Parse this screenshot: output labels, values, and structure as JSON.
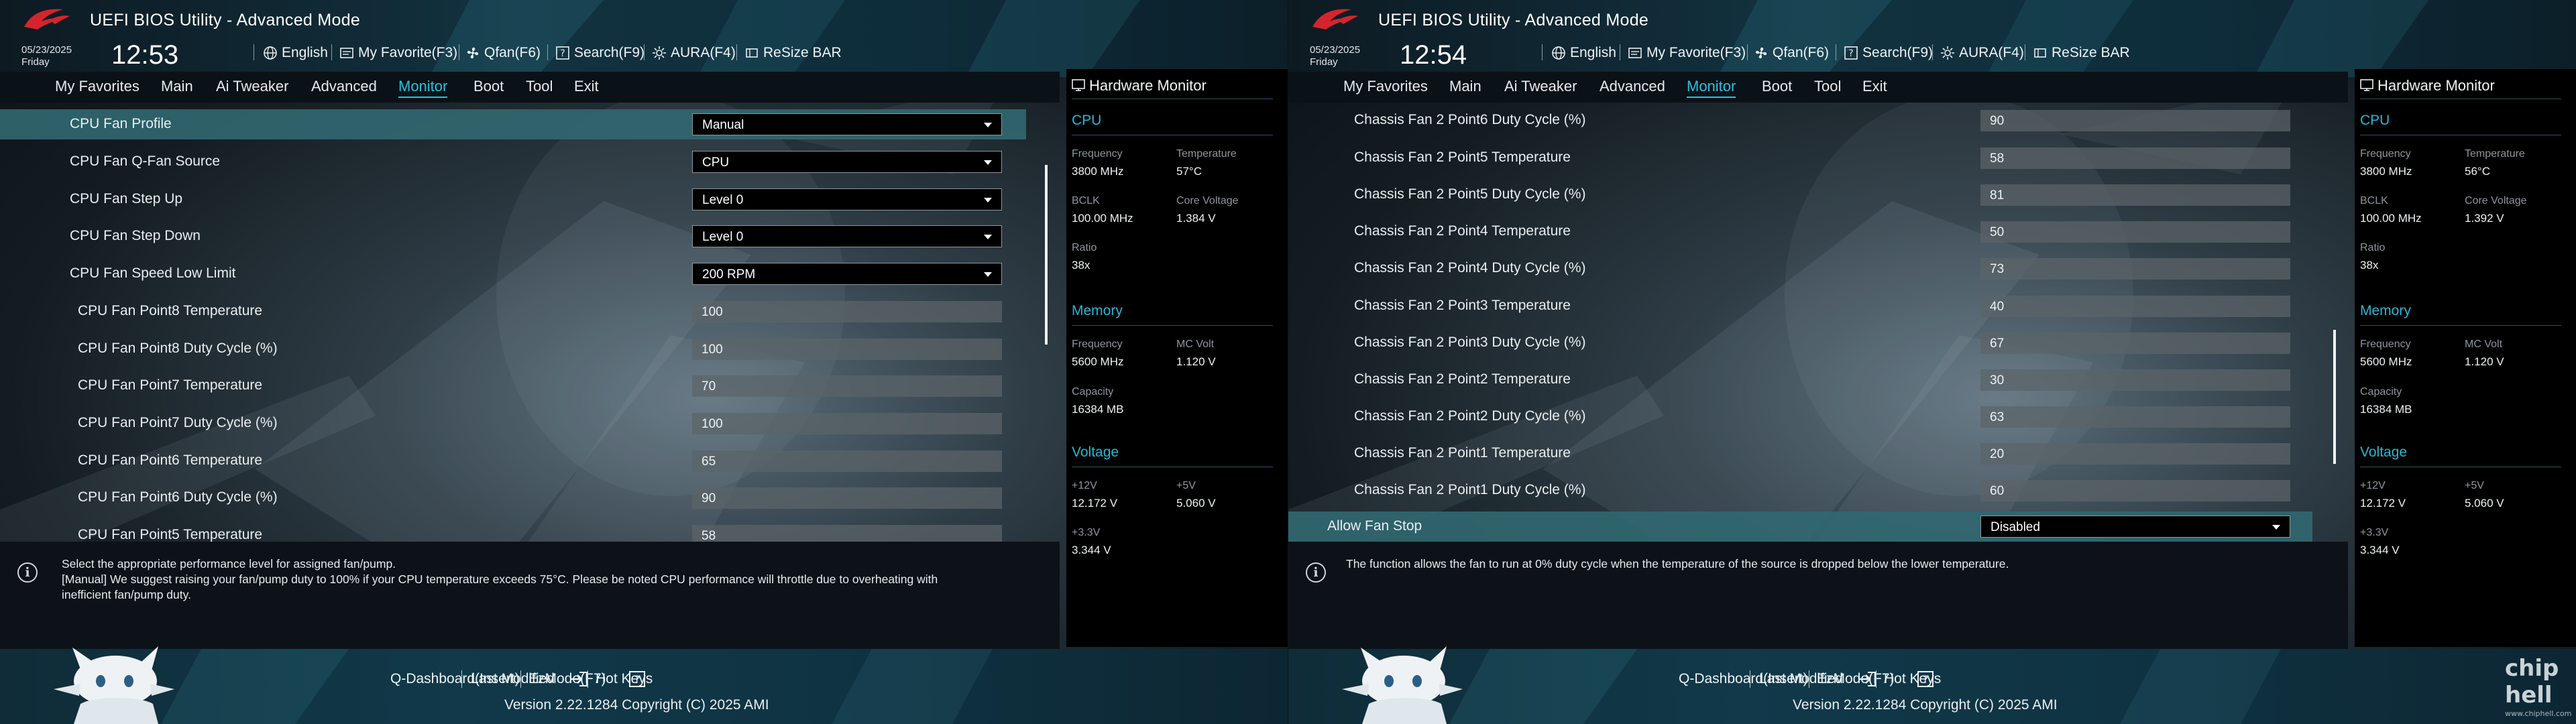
{
  "left": {
    "header": {
      "title": "UEFI BIOS Utility - Advanced Mode",
      "date": "05/23/2025",
      "day": "Friday",
      "time": "12:53",
      "toolbar": {
        "language": "English",
        "favorite": "My Favorite(F3)",
        "qfan": "Qfan(F6)",
        "search": "Search(F9)",
        "aura": "AURA(F4)",
        "resize": "ReSize BAR"
      }
    },
    "menu": [
      "My Favorites",
      "Main",
      "Ai Tweaker",
      "Advanced",
      "Monitor",
      "Boot",
      "Tool",
      "Exit"
    ],
    "active_menu": "Monitor",
    "rows": [
      {
        "label": "CPU Fan Profile",
        "value": "Manual",
        "type": "dropdown",
        "selected": true
      },
      {
        "label": "CPU Fan Q-Fan Source",
        "value": "CPU",
        "type": "dropdown"
      },
      {
        "label": "CPU Fan Step Up",
        "value": "Level 0",
        "type": "dropdown"
      },
      {
        "label": "CPU Fan Step Down",
        "value": "Level 0",
        "type": "dropdown"
      },
      {
        "label": "CPU Fan Speed Low Limit",
        "value": "200 RPM",
        "type": "dropdown"
      },
      {
        "label": "CPU Fan Point8 Temperature",
        "value": "100",
        "type": "input"
      },
      {
        "label": "CPU Fan Point8 Duty Cycle (%)",
        "value": "100",
        "type": "input"
      },
      {
        "label": "CPU Fan Point7 Temperature",
        "value": "70",
        "type": "input"
      },
      {
        "label": "CPU Fan Point7 Duty Cycle (%)",
        "value": "100",
        "type": "input"
      },
      {
        "label": "CPU Fan Point6 Temperature",
        "value": "65",
        "type": "input"
      },
      {
        "label": "CPU Fan Point6 Duty Cycle (%)",
        "value": "90",
        "type": "input"
      },
      {
        "label": "CPU Fan Point5 Temperature",
        "value": "58",
        "type": "input"
      }
    ],
    "help_lines": [
      "Select the appropriate performance level for assigned fan/pump.",
      "[Manual] We suggest raising your fan/pump duty to 100% if your CPU temperature exceeds 75°C. Please be noted CPU performance will throttle due to overheating with",
      "inefficient fan/pump duty."
    ],
    "hw": {
      "title": "Hardware Monitor",
      "cpu": {
        "section": "CPU",
        "frequency_label": "Frequency",
        "frequency": "3800 MHz",
        "temperature_label": "Temperature",
        "temperature": "57°C",
        "bclk_label": "BCLK",
        "bclk": "100.00 MHz",
        "core_voltage_label": "Core Voltage",
        "core_voltage": "1.384 V",
        "ratio_label": "Ratio",
        "ratio": "38x"
      },
      "memory": {
        "section": "Memory",
        "frequency_label": "Frequency",
        "frequency": "5600 MHz",
        "mc_volt_label": "MC Volt",
        "mc_volt": "1.120 V",
        "capacity_label": "Capacity",
        "capacity": "16384 MB"
      },
      "voltage": {
        "section": "Voltage",
        "v12_label": "+12V",
        "v12": "12.172 V",
        "v5_label": "+5V",
        "v5": "5.060 V",
        "v33_label": "+3.3V",
        "v33": "3.344 V"
      }
    },
    "footer": {
      "qdash": "Q-Dashboard(Insert)",
      "last_modified": "Last Modified",
      "ezmode": "EzMode(F7)",
      "hotkeys": "Hot Keys",
      "version": "Version 2.22.1284 Copyright (C) 2025 AMI"
    }
  },
  "right": {
    "header": {
      "title": "UEFI BIOS Utility - Advanced Mode",
      "date": "05/23/2025",
      "day": "Friday",
      "time": "12:54",
      "toolbar": {
        "language": "English",
        "favorite": "My Favorite(F3)",
        "qfan": "Qfan(F6)",
        "search": "Search(F9)",
        "aura": "AURA(F4)",
        "resize": "ReSize BAR"
      }
    },
    "menu": [
      "My Favorites",
      "Main",
      "Ai Tweaker",
      "Advanced",
      "Monitor",
      "Boot",
      "Tool",
      "Exit"
    ],
    "active_menu": "Monitor",
    "rows": [
      {
        "label": "Chassis Fan 2 Point6 Duty Cycle (%)",
        "value": "90",
        "type": "input"
      },
      {
        "label": "Chassis Fan 2 Point5 Temperature",
        "value": "58",
        "type": "input"
      },
      {
        "label": "Chassis Fan 2 Point5 Duty Cycle (%)",
        "value": "81",
        "type": "input"
      },
      {
        "label": "Chassis Fan 2 Point4 Temperature",
        "value": "50",
        "type": "input"
      },
      {
        "label": "Chassis Fan 2 Point4 Duty Cycle (%)",
        "value": "73",
        "type": "input"
      },
      {
        "label": "Chassis Fan 2 Point3 Temperature",
        "value": "40",
        "type": "input"
      },
      {
        "label": "Chassis Fan 2 Point3 Duty Cycle (%)",
        "value": "67",
        "type": "input"
      },
      {
        "label": "Chassis Fan 2 Point2 Temperature",
        "value": "30",
        "type": "input"
      },
      {
        "label": "Chassis Fan 2 Point2 Duty Cycle (%)",
        "value": "63",
        "type": "input"
      },
      {
        "label": "Chassis Fan 2 Point1 Temperature",
        "value": "20",
        "type": "input"
      },
      {
        "label": "Chassis Fan 2 Point1 Duty Cycle (%)",
        "value": "60",
        "type": "input"
      },
      {
        "label": "Allow Fan Stop",
        "value": "Disabled",
        "type": "dropdown",
        "selected": true
      }
    ],
    "help_lines": [
      "The function allows the fan to run at 0% duty cycle when the temperature of the source is dropped below the lower temperature."
    ],
    "hw": {
      "title": "Hardware Monitor",
      "cpu": {
        "section": "CPU",
        "frequency_label": "Frequency",
        "frequency": "3800 MHz",
        "temperature_label": "Temperature",
        "temperature": "56°C",
        "bclk_label": "BCLK",
        "bclk": "100.00 MHz",
        "core_voltage_label": "Core Voltage",
        "core_voltage": "1.392 V",
        "ratio_label": "Ratio",
        "ratio": "38x"
      },
      "memory": {
        "section": "Memory",
        "frequency_label": "Frequency",
        "frequency": "5600 MHz",
        "mc_volt_label": "MC Volt",
        "mc_volt": "1.120 V",
        "capacity_label": "Capacity",
        "capacity": "16384 MB"
      },
      "voltage": {
        "section": "Voltage",
        "v12_label": "+12V",
        "v12": "12.172 V",
        "v5_label": "+5V",
        "v5": "5.060 V",
        "v33_label": "+3.3V",
        "v33": "3.344 V"
      }
    },
    "footer": {
      "qdash": "Q-Dashboard(Insert)",
      "last_modified": "Last Modified",
      "ezmode": "EzMode(F7)",
      "hotkeys": "Hot Keys",
      "version": "Version 2.22.1284 Copyright (C) 2025 AMI"
    },
    "watermark": "chiphell",
    "watermark_url": "www.chiphell.com"
  },
  "colors": {
    "accent": "#27c2e0",
    "selected_row": "#316870",
    "hw_section": "#27b8d6",
    "panel_bg": "#000000"
  }
}
